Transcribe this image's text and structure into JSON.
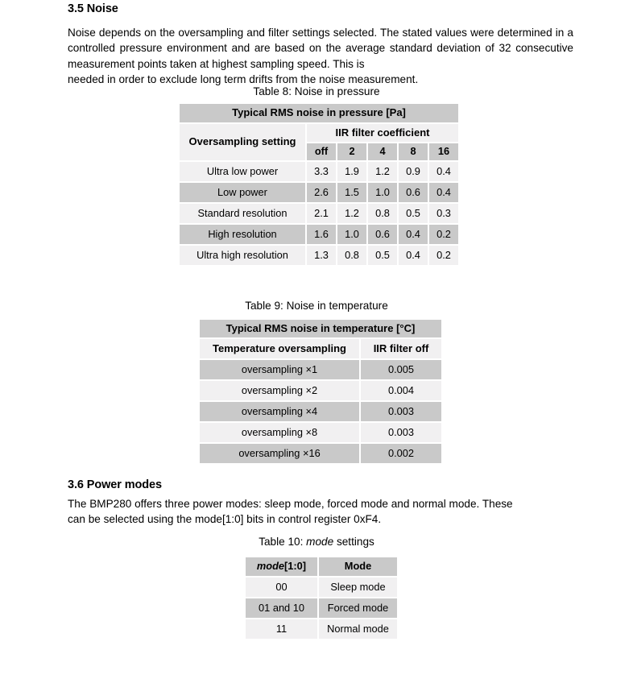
{
  "sections": {
    "noise": {
      "heading": "3.5 Noise",
      "paragraph_main": "Noise depends on the oversampling and filter settings selected. The stated values were determined in a controlled pressure environment and are based on the average standard deviation of 32 consecutive measurement points taken at highest sampling speed. This is",
      "paragraph_last": "needed in order to exclude long term drifts from the noise measurement."
    },
    "power_modes": {
      "heading": "3.6 Power modes",
      "paragraph_main": "The BMP280 offers three power modes: sleep mode, forced mode and normal mode. These",
      "paragraph_last": "can be selected using the mode[1:0] bits in control register 0xF4."
    }
  },
  "captions": {
    "table8": "Table 8: Noise in pressure",
    "table9": "Table 9: Noise in temperature",
    "table10_prefix": "Table 10: ",
    "table10_italic": "mode",
    "table10_suffix": " settings"
  },
  "table8": {
    "banner": "Typical RMS noise in pressure [Pa]",
    "row_header": "Oversampling setting",
    "group_header": "IIR filter coefficient",
    "columns": [
      "off",
      "2",
      "4",
      "8",
      "16"
    ],
    "rows": [
      {
        "label": "Ultra low power",
        "values": [
          "3.3",
          "1.9",
          "1.2",
          "0.9",
          "0.4"
        ]
      },
      {
        "label": "Low power",
        "values": [
          "2.6",
          "1.5",
          "1.0",
          "0.6",
          "0.4"
        ]
      },
      {
        "label": "Standard resolution",
        "values": [
          "2.1",
          "1.2",
          "0.8",
          "0.5",
          "0.3"
        ]
      },
      {
        "label": "High resolution",
        "values": [
          "1.6",
          "1.0",
          "0.6",
          "0.4",
          "0.2"
        ]
      },
      {
        "label": "Ultra high resolution",
        "values": [
          "1.3",
          "0.8",
          "0.5",
          "0.4",
          "0.2"
        ]
      }
    ]
  },
  "table9": {
    "banner": "Typical RMS noise in temperature [°C]",
    "col1_header": "Temperature oversampling",
    "col2_header": "IIR filter off",
    "rows": [
      {
        "label": "oversampling ×1",
        "value": "0.005"
      },
      {
        "label": "oversampling ×2",
        "value": "0.004"
      },
      {
        "label": "oversampling ×4",
        "value": "0.003"
      },
      {
        "label": "oversampling ×8",
        "value": "0.003"
      },
      {
        "label": "oversampling ×16",
        "value": "0.002"
      }
    ]
  },
  "table10": {
    "col1_header_italic": "mode",
    "col1_header_rest": "[1:0]",
    "col2_header": "Mode",
    "rows": [
      {
        "bits": "00",
        "mode": "Sleep mode"
      },
      {
        "bits": "01 and 10",
        "mode": "Forced mode"
      },
      {
        "bits": "11",
        "mode": "Normal mode"
      }
    ]
  },
  "colors": {
    "header_gray": "#c9c9c9",
    "row_light": "#f1f0f1",
    "page_background": "#ffffff",
    "text": "#000000"
  }
}
